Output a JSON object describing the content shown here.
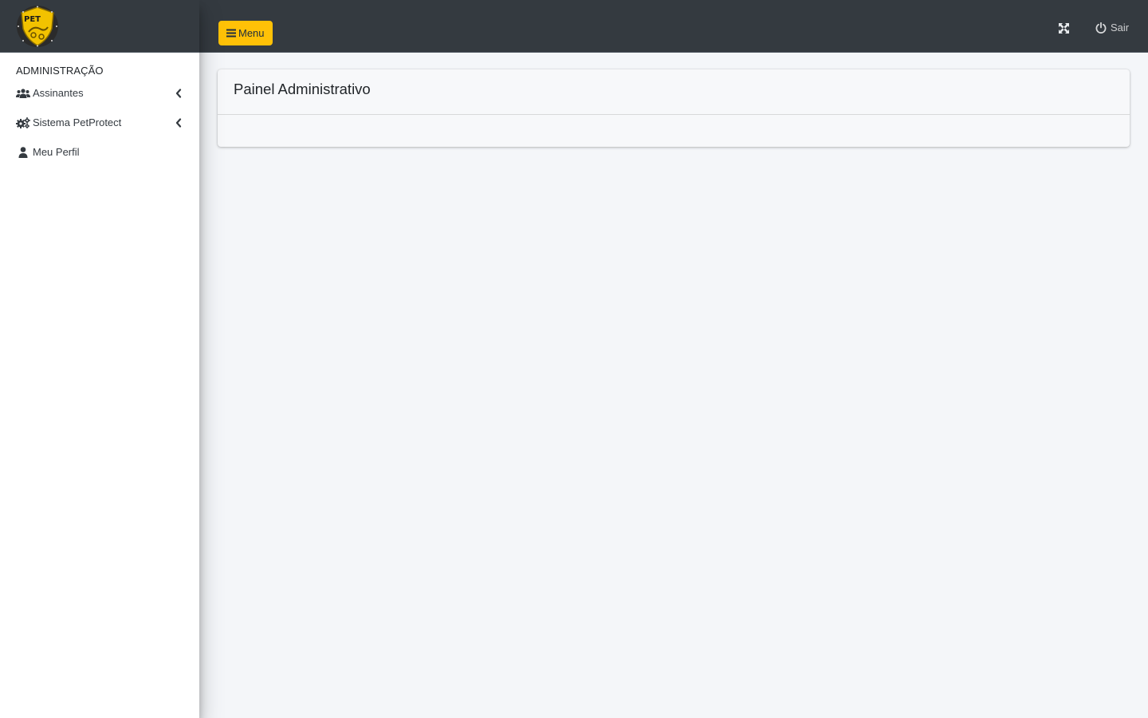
{
  "brand": {
    "logo_icon": "petprotect-shield-logo",
    "logo_text": "PET"
  },
  "sidebar": {
    "section_header": "ADMINISTRAÇÃO",
    "items": [
      {
        "label": "Assinantes",
        "icon": "users-icon",
        "has_submenu": true
      },
      {
        "label": "Sistema PetProtect",
        "icon": "cogs-icon",
        "has_submenu": true
      },
      {
        "label": "Meu Perfil",
        "icon": "user-icon",
        "has_submenu": false
      }
    ]
  },
  "topbar": {
    "menu_label": "Menu",
    "menu_icon": "bars-icon",
    "fullscreen_icon": "expand-icon",
    "logout_label": "Sair",
    "logout_icon": "power-icon"
  },
  "main": {
    "card_title": "Painel Administrativo"
  },
  "colors": {
    "navbar": "#343a40",
    "accent": "#ffc107",
    "content_bg": "#f4f6f9",
    "sidebar_bg": "#ffffff"
  }
}
